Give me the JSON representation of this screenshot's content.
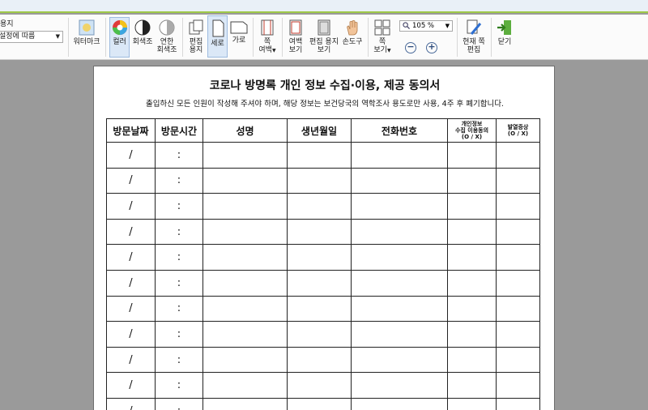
{
  "ribbon": {
    "paper_label": "용지",
    "paper_select": "설정에 따름",
    "watermark": "워터마크",
    "color": "컬러",
    "grayscale": "회색조",
    "light_grayscale_1": "연한",
    "light_grayscale_2": "회색조",
    "edit_paper_1": "편집",
    "edit_paper_2": "용지",
    "portrait": "세로",
    "landscape": "가로",
    "page_margin_1": "쪽",
    "page_margin_2": "여백",
    "margin_view_1": "여백",
    "margin_view_2": "보기",
    "edit_paper_view_1": "편집 용지",
    "edit_paper_view_2": "보기",
    "hand_tool": "손도구",
    "page_view_1": "쪽",
    "page_view_2": "보기",
    "zoom_value": "105 %",
    "current_page_edit_1": "현재 쪽",
    "current_page_edit_2": "편집",
    "close": "닫기"
  },
  "document": {
    "title": "코로나 방명록 개인 정보 수집·이용, 제공 동의서",
    "subtitle": "출입하신 모든 인원이 작성해 주셔야 하며, 해당 정보는 보건당국의 역학조사 용도로만 사용, 4주 후 폐기합니다.",
    "headers": {
      "visit_date": "방문날짜",
      "visit_time": "방문시간",
      "name": "성명",
      "birth": "생년월일",
      "phone": "전화번호",
      "consent_1": "개인정보",
      "consent_2": "수집 이용동의",
      "consent_3": "(O / X)",
      "fever_1": "발열증상",
      "fever_2": "(O / X)"
    },
    "row_date_mark": "/",
    "row_time_mark": ":",
    "rows": 11
  },
  "colors": {
    "ribbon_accent": "#9fc948",
    "workspace": "#9a9a9a"
  }
}
